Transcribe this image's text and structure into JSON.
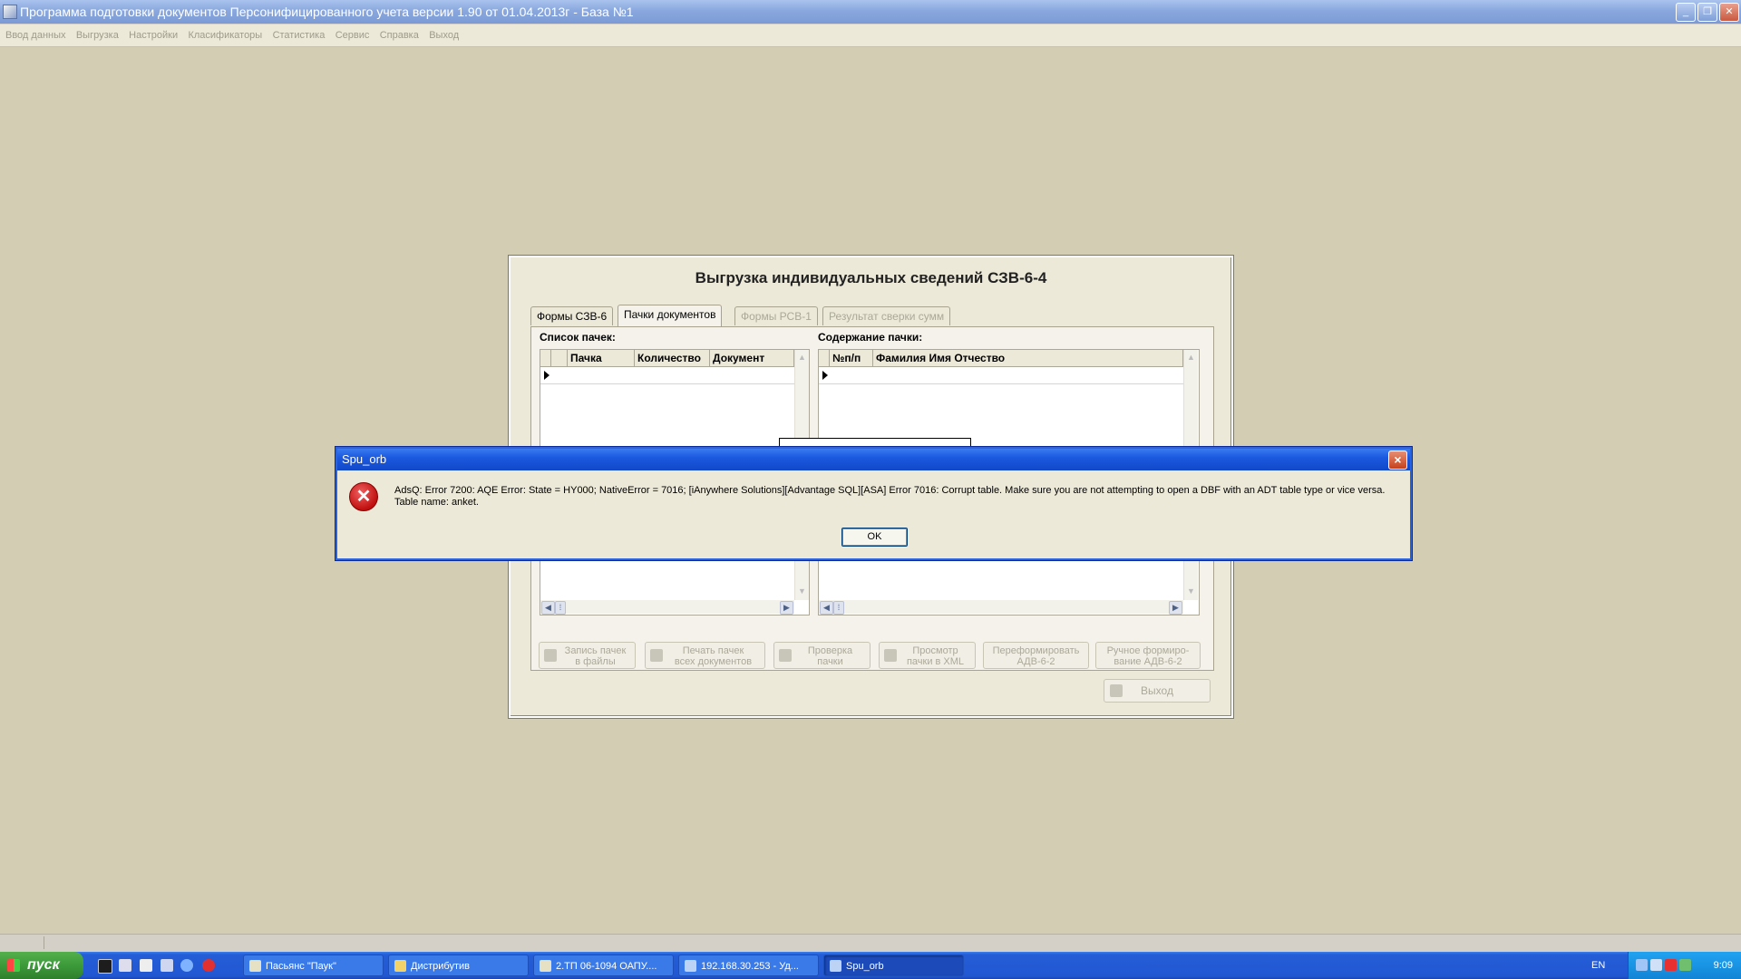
{
  "window": {
    "title": "Программа подготовки документов Персонифицированного учета версии 1.90 от 01.04.2013г - База №1",
    "minimize": "_",
    "restore": "❐",
    "close": "✕"
  },
  "menu": [
    "Ввод данных",
    "Выгрузка",
    "Настройки",
    "Класификаторы",
    "Статистика",
    "Сервис",
    "Справка",
    "Выход"
  ],
  "export_dialog": {
    "title": "Выгрузка индивидуальных сведений СЗВ-6-4",
    "tabs": [
      "Формы СЗВ-6",
      "Пачки документов",
      "Формы РСВ-1",
      "Результат сверки сумм"
    ],
    "active_tab": "Пачки документов",
    "left_label": "Список пачек:",
    "right_label": "Содержание пачки:",
    "left_columns": [
      "Пачка",
      "Количество",
      "Документ"
    ],
    "right_columns": [
      "№п/п",
      "Фамилия Имя Отчество"
    ],
    "buttons": [
      [
        "Запись пачек",
        "в файлы"
      ],
      [
        "Печать пачек",
        "всех документов"
      ],
      [
        "Проверка",
        "пачки"
      ],
      [
        "Просмотр",
        "пачки в XML"
      ],
      [
        "Переформировать",
        "АДВ-6-2"
      ],
      [
        "Ручное формиро-",
        "вание АДВ-6-2"
      ]
    ],
    "exit": "Выход"
  },
  "error_dialog": {
    "title": "Spu_orb",
    "message_line1": "AdsQ: Error 7200:  AQE Error:  State = HY000;   NativeError = 7016;  [iAnywhere Solutions][Advantage SQL][ASA] Error 7016:  Corrupt table.  Make sure you are not attempting to open a DBF with an ADT table type or vice versa.",
    "message_line2": "Table name: anket.",
    "ok": "OK",
    "icon": "error-x-icon"
  },
  "taskbar": {
    "start": "пуск",
    "tasks": [
      "Пасьянс \"Паук\"",
      "Дистрибутив",
      "2.ТП 06-1094 ОАПУ....",
      "192.168.30.253 - Уд...",
      "Spu_orb"
    ],
    "active_task": "Spu_orb",
    "lang": "EN",
    "clock": "9:09"
  },
  "colors": {
    "desktop": "#d2cdb3",
    "xp_blue": "#2257d2",
    "start_green": "#3c9a3a",
    "error_red": "#c01010"
  }
}
